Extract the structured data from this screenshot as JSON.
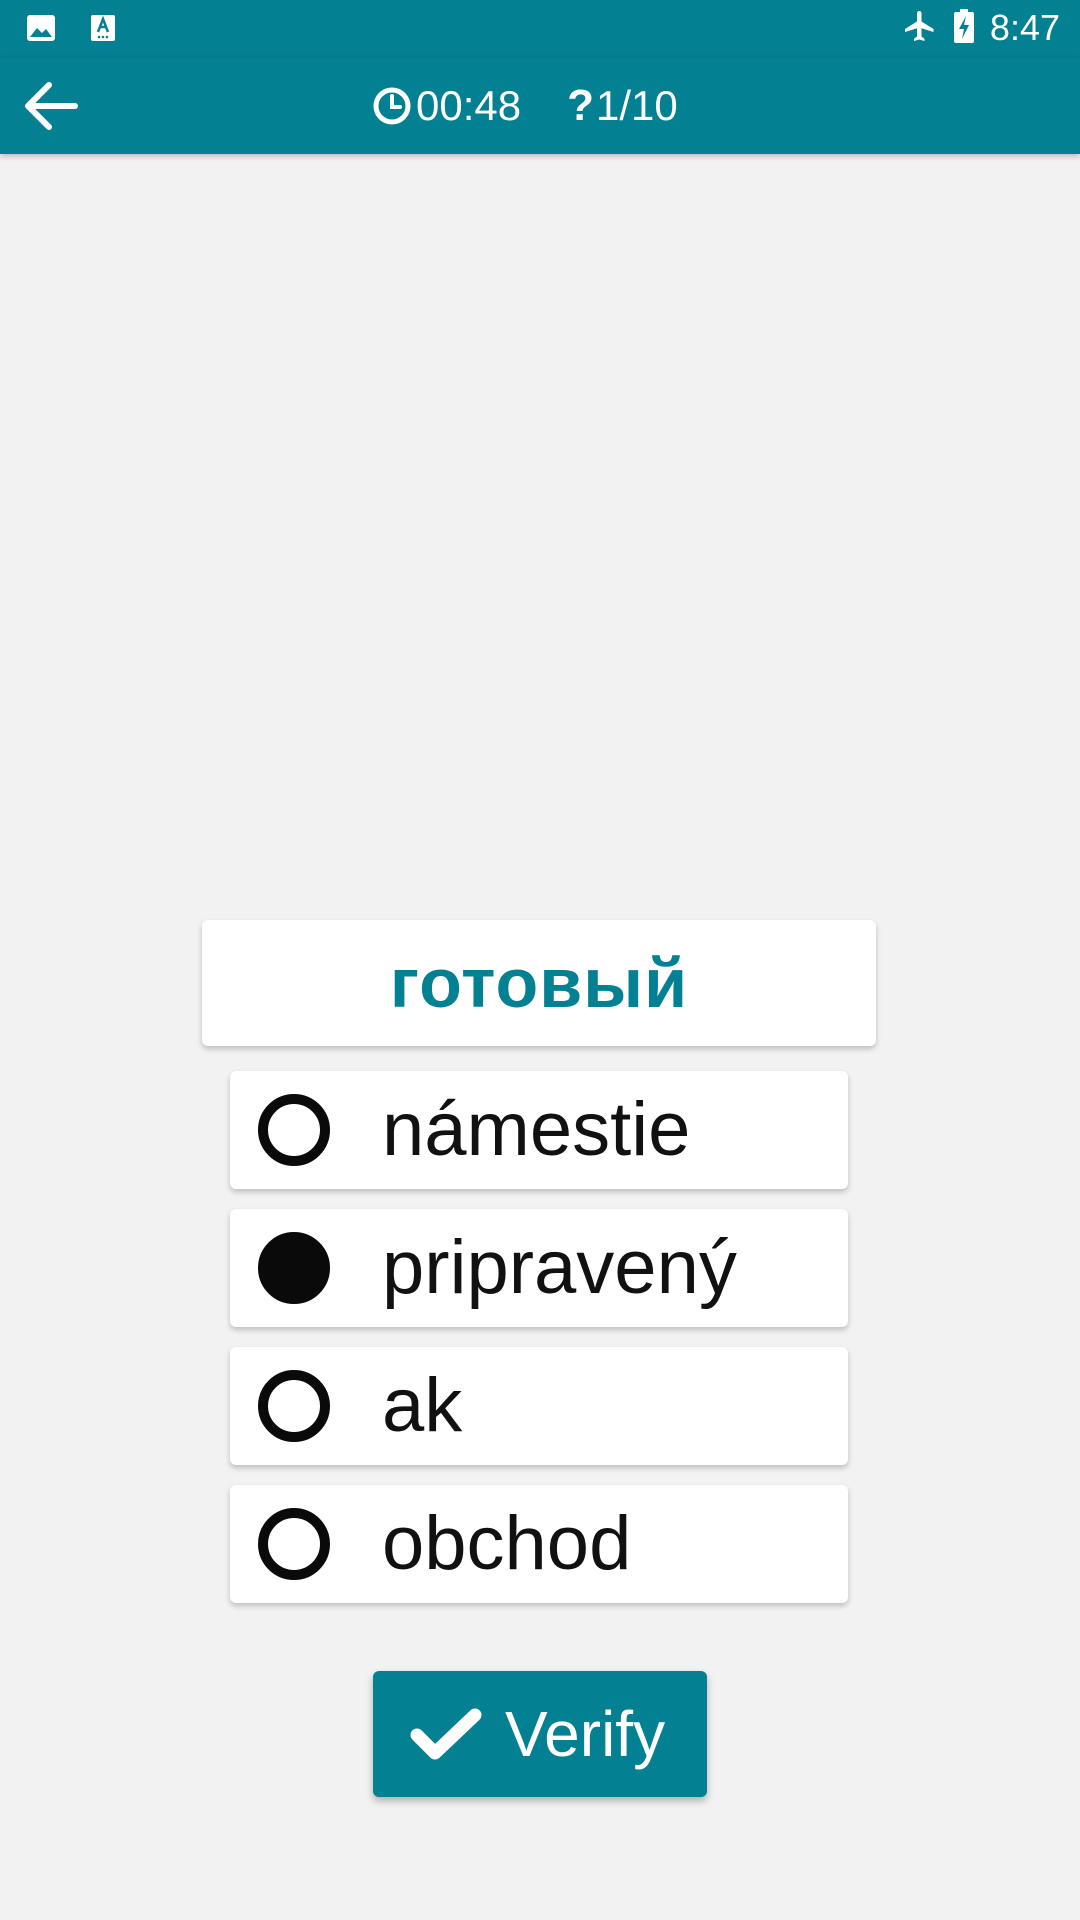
{
  "colors": {
    "accent": "#038193",
    "background": "#f2f2f2",
    "card": "#ffffff",
    "text": "#111111"
  },
  "status_bar": {
    "left_icons": [
      "image-icon",
      "keyboard-a-icon"
    ],
    "right_icons": [
      "airplane-mode-icon",
      "battery-charging-icon"
    ],
    "time": "8:47"
  },
  "toolbar": {
    "back_icon": "arrow-left-icon",
    "timer_icon": "clock-icon",
    "timer": "00:48",
    "question_icon": "?",
    "progress": "1/10"
  },
  "quiz": {
    "word": "готовый",
    "options": [
      {
        "label": "námestie",
        "selected": false
      },
      {
        "label": "pripravený",
        "selected": true
      },
      {
        "label": "ak",
        "selected": false
      },
      {
        "label": "obchod",
        "selected": false
      }
    ]
  },
  "verify_button": {
    "icon": "checkmark-icon",
    "label": "Verify"
  }
}
